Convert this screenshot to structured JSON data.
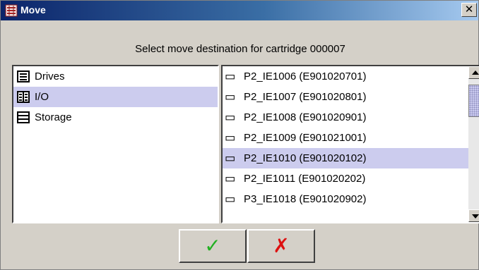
{
  "window": {
    "title": "Move",
    "close_glyph": "✕"
  },
  "prompt": "Select move destination for cartridge 000007",
  "locations": [
    {
      "label": "Drives",
      "icon": "drives-icon",
      "selected": false
    },
    {
      "label": "I/O",
      "icon": "io-icon",
      "selected": true
    },
    {
      "label": "Storage",
      "icon": "storage-icon",
      "selected": false
    }
  ],
  "slots": [
    {
      "label": "P2_IE1006 (E901020701)",
      "selected": false
    },
    {
      "label": "P2_IE1007 (E901020801)",
      "selected": false
    },
    {
      "label": "P2_IE1008 (E901020901)",
      "selected": false
    },
    {
      "label": "P2_IE1009 (E901021001)",
      "selected": false
    },
    {
      "label": "P2_IE1010 (E901020102)",
      "selected": true
    },
    {
      "label": "P2_IE1011 (E901020202)",
      "selected": false
    },
    {
      "label": "P3_IE1018 (E901020902)",
      "selected": false
    }
  ],
  "cartridge_glyph": "⊏⊐",
  "buttons": {
    "ok_glyph": "✓",
    "cancel_glyph": "✗"
  },
  "colors": {
    "selection": "#ccccee",
    "ok": "#22b022",
    "cancel": "#dd1111"
  }
}
